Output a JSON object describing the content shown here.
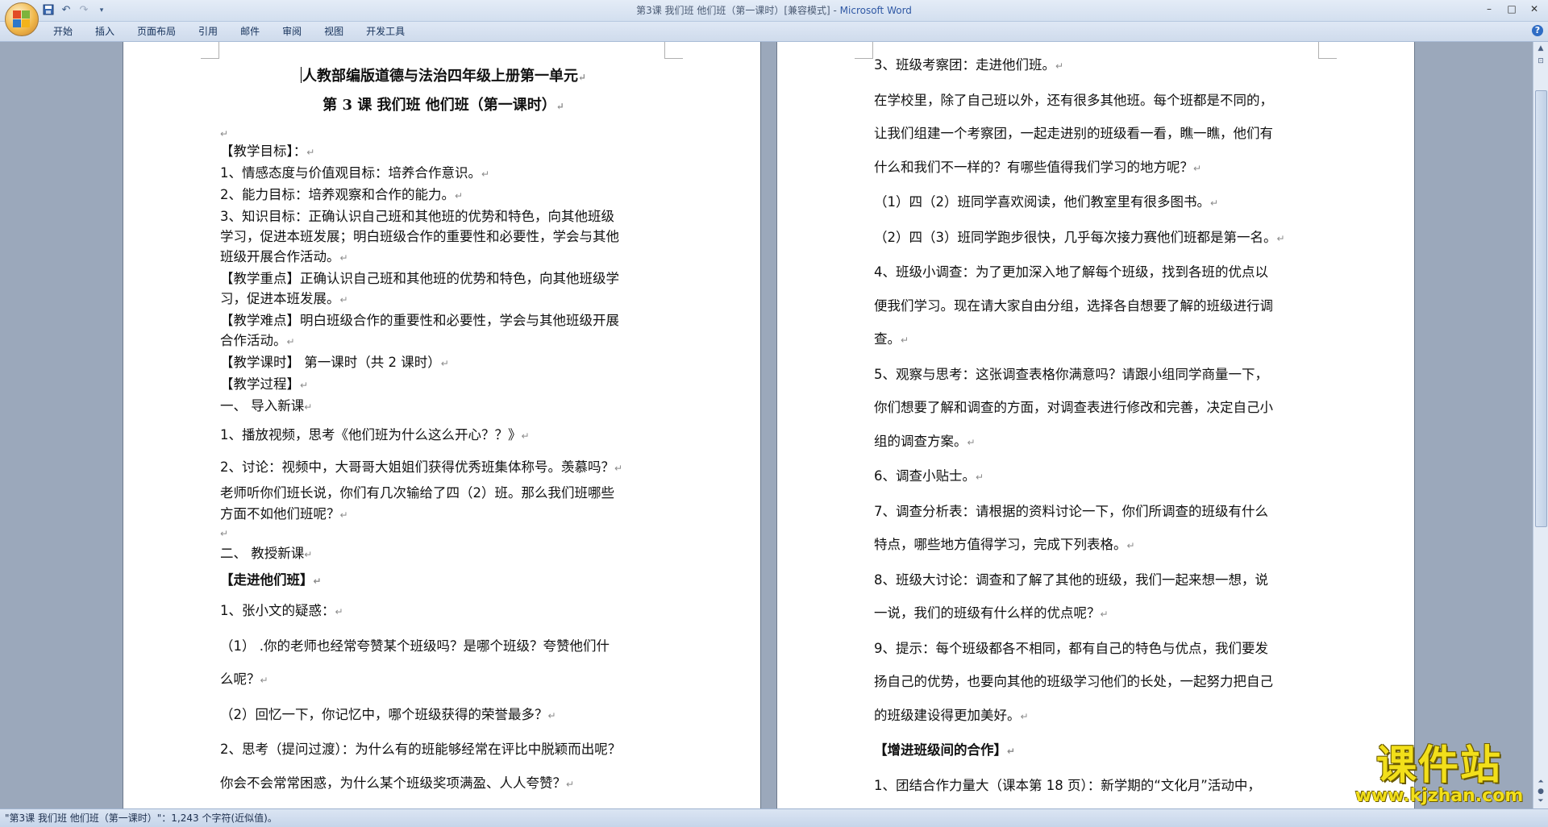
{
  "window": {
    "title": "第3课 我们班  他们班（第一课时）[兼容模式] - ",
    "app_name": "Microsoft Word",
    "controls": [
      "–",
      "□",
      "✕"
    ]
  },
  "qat": {
    "save_icon": "save-icon",
    "undo_icon": "undo-icon",
    "redo_icon": "redo-icon",
    "more": "▾"
  },
  "menu": {
    "tabs": [
      "开始",
      "插入",
      "页面布局",
      "引用",
      "邮件",
      "审阅",
      "视图",
      "开发工具"
    ],
    "help": "?"
  },
  "left_page": {
    "title1": "人教部编版道德与法治四年级上册第一单元",
    "title2": "第 3 课  我们班    他们班（第一课时）",
    "lines": [
      "【教学目标】：",
      "1、情感态度与价值观目标：培养合作意识。",
      "2、能力目标：培养观察和合作的能力。",
      "3、知识目标：正确认识自己班和其他班的优势和特色，向其他班级",
      "学习，促进本班发展；明白班级合作的重要性和必要性，学会与其他",
      "班级开展合作活动。",
      "【教学重点】正确认识自己班和其他班的优势和特色，向其他班级学",
      "习，促进本班发展。",
      "【教学难点】明白班级合作的重要性和必要性，学会与其他班级开展",
      "合作活动。",
      "【教学课时】 第一课时（共 2 课时）",
      "【教学过程】",
      "一、    导入新课",
      "1、播放视频，思考《他们班为什么这么开心？？》",
      "2、讨论：视频中，大哥哥大姐姐们获得优秀班集体称号。羡慕吗？",
      "老师听你们班长说，你们有几次输给了四（2）班。那么我们班哪些",
      "方面不如他们班呢？",
      "二、    教授新课",
      "【走进他们班】",
      "1、张小文的疑惑：",
      "（1）  .你的老师也经常夸赞某个班级吗？是哪个班级？夸赞他们什",
      "么呢？",
      "（2）回忆一下，你记忆中，哪个班级获得的荣誉最多？",
      "2、思考（提问过渡）：为什么有的班能够经常在评比中脱颖而出呢？",
      "你会不会常常困惑，为什么某个班级奖项满盈、人人夸赞？"
    ]
  },
  "right_page": {
    "lines": [
      "3、班级考察团：走进他们班。",
      "在学校里，除了自己班以外，还有很多其他班。每个班都是不同的，",
      "让我们组建一个考察团，一起走进别的班级看一看，瞧一瞧，他们有",
      "什么和我们不一样的？有哪些值得我们学习的地方呢？",
      "（1）四（2）班同学喜欢阅读，他们教室里有很多图书。",
      "（2）四（3）班同学跑步很快，几乎每次接力赛他们班都是第一名。",
      "4、班级小调查：为了更加深入地了解每个班级，找到各班的优点以",
      "便我们学习。现在请大家自由分组，选择各自想要了解的班级进行调",
      "查。",
      "5、观察与思考：这张调查表格你满意吗？请跟小组同学商量一下，",
      "你们想要了解和调查的方面，对调查表进行修改和完善，决定自己小",
      "组的调查方案。",
      "6、调查小贴士。",
      "7、调查分析表：请根据的资料讨论一下，你们所调查的班级有什么",
      "特点，哪些地方值得学习，完成下列表格。",
      "8、班级大讨论：调查和了解了其他的班级，我们一起来想一想，说",
      "一说，我们的班级有什么样的优点呢？",
      "9、提示：每个班级都各不相同，都有自己的特色与优点，我们要发",
      "扬自己的优势，也要向其他的班级学习他们的长处，一起努力把自己",
      "的班级建设得更加美好。",
      "【增进班级间的合作】",
      "1、团结合作力量大（课本第 18 页）：新学期的“文化月”活动中，"
    ]
  },
  "paragraph_mark": "↵",
  "status": {
    "text": "\"第3课 我们班  他们班（第一课时）\"：1,243 个字符(近似值)。"
  },
  "watermark": {
    "line1": "课件站",
    "line2": "www.kjzhan.com"
  }
}
